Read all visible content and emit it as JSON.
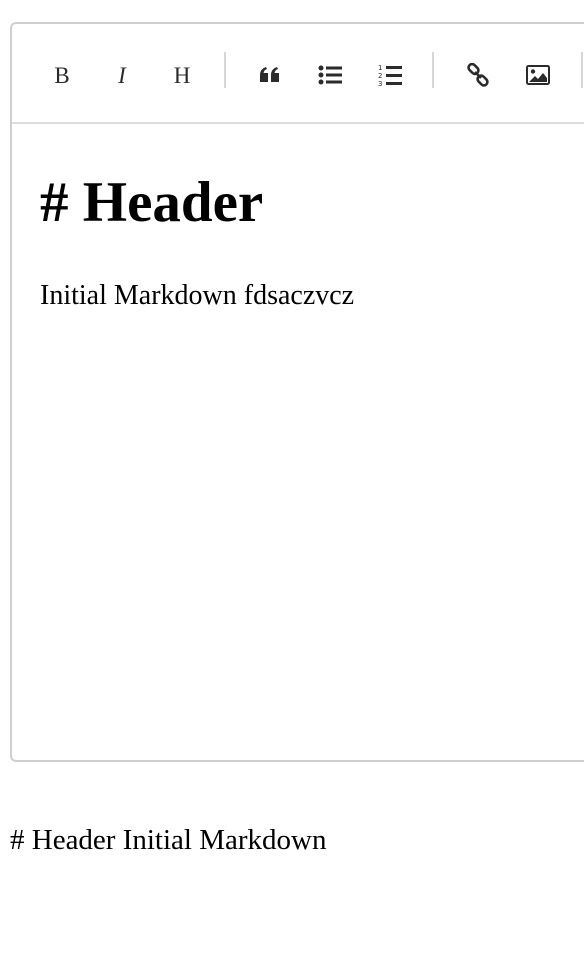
{
  "toolbar": {
    "buttons": [
      {
        "label": "B",
        "icon": "bold-icon"
      },
      {
        "label": "I",
        "icon": "italic-icon"
      },
      {
        "label": "H",
        "icon": "heading-icon"
      },
      {
        "icon": "quote-icon"
      },
      {
        "icon": "bulleted-list-icon"
      },
      {
        "icon": "numbered-list-icon"
      },
      {
        "icon": "link-icon"
      },
      {
        "icon": "image-icon"
      }
    ]
  },
  "editor": {
    "heading": "# Header",
    "paragraph": "Initial Markdown fdsaczvcz"
  },
  "output": {
    "text": "# Header Initial Markdown"
  }
}
